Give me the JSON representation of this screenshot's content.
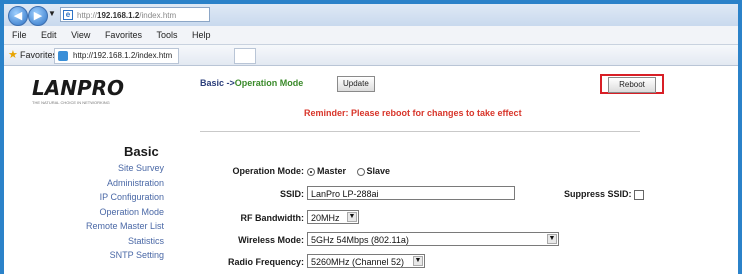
{
  "browser": {
    "url_prefix": "http://",
    "url_host": "192.168.1.2",
    "url_path": "/index.htm",
    "menu": [
      "File",
      "Edit",
      "View",
      "Favorites",
      "Tools",
      "Help"
    ],
    "favorites_label": "Favorites",
    "tab_title": "http://192.168.1.2/index.htm"
  },
  "header": {
    "logo": "LANPRO",
    "logo_tagline": "THE NATURAL CHOICE IN NETWORKING",
    "breadcrumb_base": "Basic ->",
    "breadcrumb_current": "Operation Mode",
    "update_label": "Update",
    "reboot_label": "Reboot",
    "reminder": "Reminder: Please reboot for changes to take effect"
  },
  "sidebar": {
    "title": "Basic",
    "items": [
      "Site Survey",
      "Administration",
      "IP Configuration",
      "Operation Mode",
      "Remote Master List",
      "Statistics",
      "SNTP Setting"
    ]
  },
  "form": {
    "operation_mode_label": "Operation Mode:",
    "master_label": "Master",
    "slave_label": "Slave",
    "ssid_label": "SSID:",
    "ssid_value": "LanPro LP-288ai",
    "suppress_ssid_label": "Suppress SSID:",
    "rf_bandwidth_label": "RF Bandwidth:",
    "rf_bandwidth_value": "20MHz",
    "wireless_mode_label": "Wireless Mode:",
    "wireless_mode_value": "5GHz 54Mbps (802.11a)",
    "radio_frequency_label": "Radio Frequency:",
    "radio_frequency_value": "5260MHz (Channel 52)"
  }
}
